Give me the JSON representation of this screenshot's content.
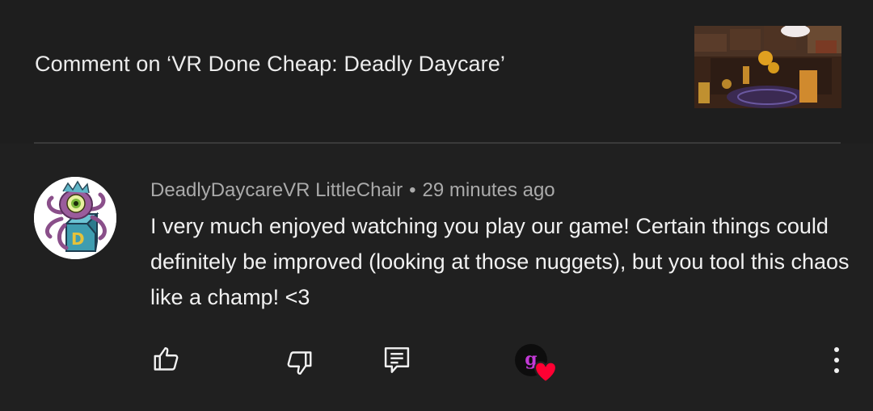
{
  "header": {
    "title": "Comment on ‘VR Done Cheap: Deadly Daycare’",
    "thumbnail_icon": "video-thumbnail"
  },
  "comment": {
    "author": "DeadlyDaycareVR LittleChair",
    "separator": "•",
    "timestamp": "29 minutes ago",
    "text": "I very much enjoyed watching you play our game! Certain things could definitely be improved (looking at those nuggets), but you tool this chaos like a champ! <3",
    "avatar_icon": "octopus-eye-box-avatar"
  },
  "actions": {
    "like_icon": "thumbs-up-icon",
    "dislike_icon": "thumbs-down-icon",
    "reply_icon": "reply-icon",
    "creator_heart": {
      "avatar_letter": "g",
      "heart_color": "#ff0033"
    },
    "more_icon": "more-vert-icon"
  },
  "colors": {
    "background": "#202020",
    "header_background": "#1e1e1e",
    "text_primary": "#f1f1f1",
    "text_secondary": "#aaaaaa"
  }
}
